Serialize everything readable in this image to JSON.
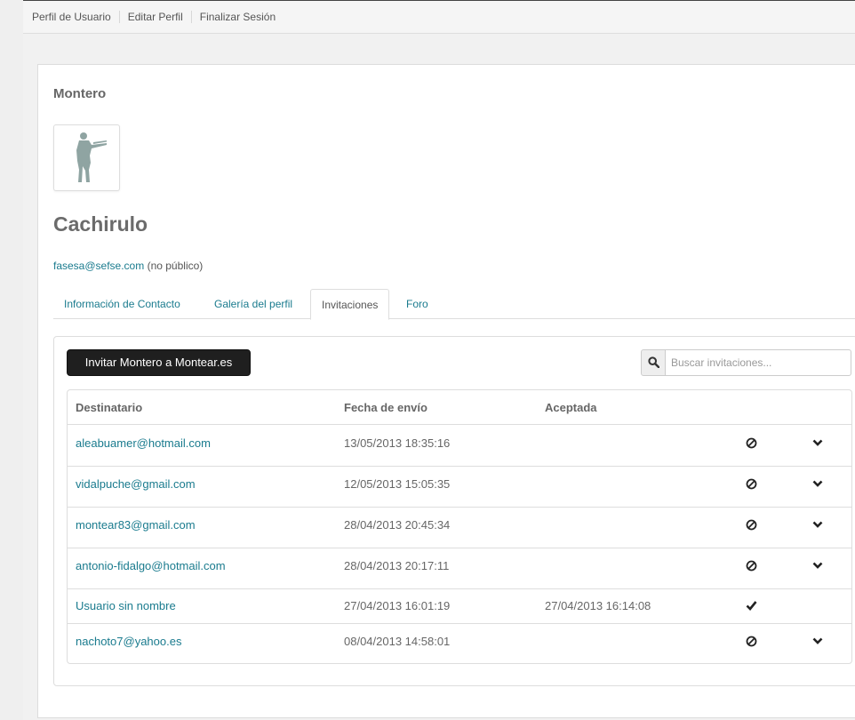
{
  "topnav": {
    "items": [
      "Perfil de Usuario",
      "Editar Perfil",
      "Finalizar Sesión"
    ]
  },
  "profile": {
    "section_title": "Montero",
    "name": "Cachirulo",
    "email": "fasesa@sefse.com",
    "email_note": "(no público)",
    "avatar_icon": "hunter-silhouette-icon"
  },
  "tabs": [
    {
      "label": "Información de Contacto",
      "active": false
    },
    {
      "label": "Galería del perfil",
      "active": false
    },
    {
      "label": "Invitaciones",
      "active": true
    },
    {
      "label": "Foro",
      "active": false
    }
  ],
  "invitations": {
    "invite_button": "Invitar Montero a Montear.es",
    "search_placeholder": "Buscar invitaciones...",
    "search_icon": "search-icon",
    "columns": [
      "Destinatario",
      "Fecha de envío",
      "Aceptada"
    ],
    "rows": [
      {
        "recipient": "aleabuamer@hotmail.com",
        "sent": "13/05/2013 18:35:16",
        "accepted": "",
        "status_icon": "ban-icon",
        "has_expand": true
      },
      {
        "recipient": "vidalpuche@gmail.com",
        "sent": "12/05/2013 15:05:35",
        "accepted": "",
        "status_icon": "ban-icon",
        "has_expand": true
      },
      {
        "recipient": "montear83@gmail.com",
        "sent": "28/04/2013 20:45:34",
        "accepted": "",
        "status_icon": "ban-icon",
        "has_expand": true
      },
      {
        "recipient": "antonio-fidalgo@hotmail.com",
        "sent": "28/04/2013 20:17:11",
        "accepted": "",
        "status_icon": "ban-icon",
        "has_expand": true
      },
      {
        "recipient": "Usuario sin nombre",
        "sent": "27/04/2013 16:01:19",
        "accepted": "27/04/2013 16:14:08",
        "status_icon": "check-icon",
        "has_expand": false
      },
      {
        "recipient": "nachoto7@yahoo.es",
        "sent": "08/04/2013 14:58:01",
        "accepted": "",
        "status_icon": "ban-icon",
        "has_expand": true
      }
    ]
  },
  "colors": {
    "link": "#1a7b8e",
    "button_bg": "#1f1f1f",
    "text": "#555555"
  }
}
